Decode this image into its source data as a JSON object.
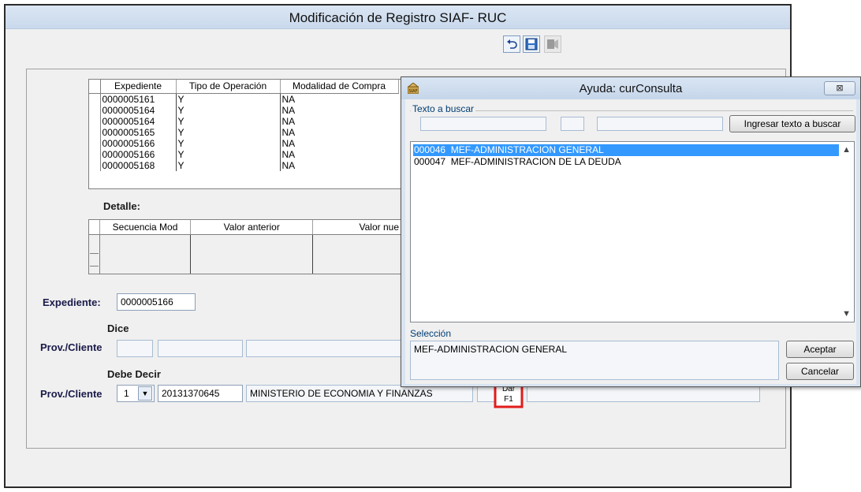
{
  "window": {
    "title": "Modificación de Registro SIAF- RUC"
  },
  "toolbar": {
    "undo_icon": "undo-icon",
    "save_icon": "save-icon",
    "exit_icon": "exit-icon"
  },
  "grid_main": {
    "columns": [
      "Expediente",
      "Tipo de Operación",
      "Modalidad de Compra"
    ],
    "rows": [
      [
        "0000005161",
        "Y",
        "NA"
      ],
      [
        "0000005164",
        "Y",
        "NA"
      ],
      [
        "0000005164",
        "Y",
        "NA"
      ],
      [
        "0000005165",
        "Y",
        "NA"
      ],
      [
        "0000005166",
        "Y",
        "NA"
      ],
      [
        "0000005166",
        "Y",
        "NA"
      ],
      [
        "0000005168",
        "Y",
        "NA"
      ]
    ]
  },
  "detalle": {
    "label": "Detalle:",
    "columns": [
      "Secuencia Mod",
      "Valor anterior",
      "Valor nue"
    ]
  },
  "form": {
    "expediente_label": "Expediente:",
    "expediente_value": "0000005166",
    "dice_label": "Dice",
    "prov_cliente_label": "Prov./Cliente",
    "debe_decir_label": "Debe Decir",
    "prov_cliente2_label": "Prov./Cliente",
    "tipo_value": "1",
    "ruc_value": "20131370645",
    "nombre_value": "MINISTERIO DE ECONOMIA Y FINANZAS"
  },
  "hint": {
    "text_line1": "Dar",
    "text_line2": "F1",
    "color": "#e31b1b"
  },
  "dialog": {
    "title": "Ayuda: curConsulta",
    "app_icon": "siaf-icon",
    "close_symbol": "⊠",
    "search_group_label": "Texto a buscar",
    "search_button": "Ingresar texto a buscar",
    "list_items": [
      "000046  MEF-ADMINISTRACION GENERAL",
      "000047  MEF-ADMINISTRACION DE LA DEUDA"
    ],
    "selected_index": 0,
    "selection_label": "Selección",
    "selection_value": "MEF-ADMINISTRACION GENERAL",
    "accept_button": "Aceptar",
    "cancel_button": "Cancelar"
  }
}
